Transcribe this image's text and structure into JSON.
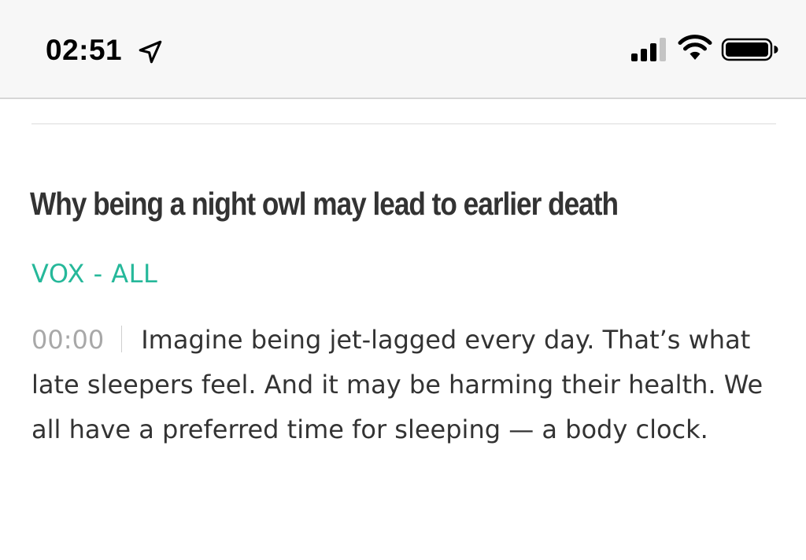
{
  "status_bar": {
    "time": "02:51",
    "icons": [
      "location-arrow-icon",
      "cellular-signal-icon",
      "wifi-icon",
      "battery-icon"
    ]
  },
  "article": {
    "title": "Why being a night owl may lead to earlier death",
    "source": "VOX - ALL",
    "timestamp": "00:00",
    "summary": "Imagine being jet-lagged every day. That’s what late sleepers feel. And it may be harming their health. We all have a preferred time for sleeping — a body clock."
  },
  "colors": {
    "status_bar_bg": "#f7f7f7",
    "title": "#333333",
    "source_accent": "#26b89a",
    "timestamp": "#a8a8a8",
    "body_text": "#333333"
  }
}
